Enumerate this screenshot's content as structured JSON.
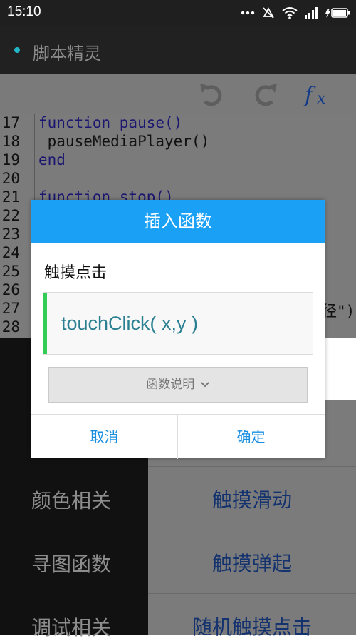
{
  "status": {
    "time": "15:10",
    "icons": [
      "more-dots-icon",
      "vibrate-off-icon",
      "wifi-icon",
      "signal-icon",
      "battery-charging-icon"
    ]
  },
  "app": {
    "title": "脚本精灵"
  },
  "toolbar": {
    "icons": [
      "undo-icon",
      "redo-icon",
      "function-icon"
    ]
  },
  "editor": {
    "line_numbers": [
      "17",
      "18",
      "19",
      "20",
      "21",
      "22",
      "23",
      "24",
      "25",
      "26",
      "27",
      "28"
    ],
    "lines": [
      {
        "text": "function pause()",
        "keyword": "function"
      },
      {
        "text": " pauseMediaPlayer()",
        "keyword": ""
      },
      {
        "text": "end",
        "keyword": "end"
      },
      {
        "text": "",
        "keyword": ""
      },
      {
        "text": "function stop()",
        "keyword": "function"
      }
    ],
    "partial_right_text": "径\")"
  },
  "sidebar": {
    "categories": [
      "颜色相关",
      "寻图函数",
      "调试相关"
    ]
  },
  "function_list": {
    "items": [
      "触摸滑动",
      "触摸弹起",
      "随机触摸点击"
    ]
  },
  "dialog": {
    "title": "插入函数",
    "function_name": "触摸点击",
    "signature": "touchClick( x,y )",
    "explain_label": "函数说明",
    "cancel_label": "取消",
    "ok_label": "确定"
  },
  "colors": {
    "dialog_header": "#1aa0f5",
    "accent_bar": "#33cc55",
    "signature_text": "#2a7f90",
    "button_text": "#1a8fe0"
  }
}
